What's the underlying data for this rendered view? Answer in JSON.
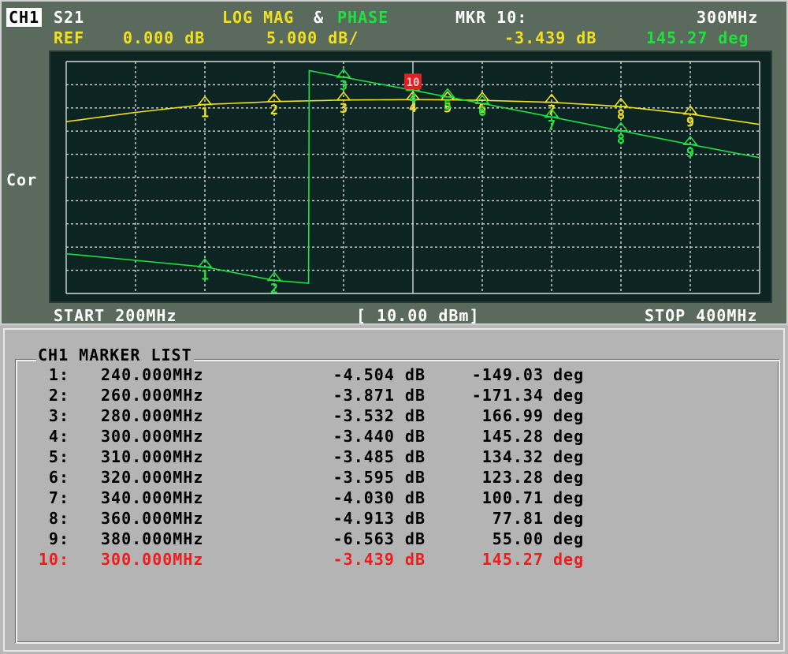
{
  "header": {
    "channel": "CH1",
    "param": "S21",
    "format_mag": "LOG MAG",
    "format_amp": "&",
    "format_phase": "PHASE",
    "marker_label": "MKR 10:",
    "marker_freq": "300MHz",
    "ref_label": "REF",
    "ref_value": "0.000 dB",
    "scale": "5.000 dB/",
    "marker_mag": "-3.439 dB",
    "marker_phase": "145.27 deg",
    "correction": "Cor"
  },
  "footer": {
    "start": "START 200MHz",
    "power": "[ 10.00 dBm]",
    "stop": "STOP 400MHz"
  },
  "chart_data": {
    "type": "line",
    "x_range_mhz": [
      200,
      400
    ],
    "mag_reference_db": 0.0,
    "mag_scale_db_per_div": 5.0,
    "grid": true,
    "series": [
      {
        "name": "LOG MAG",
        "color": "#f0e020",
        "x": [
          200,
          220,
          240,
          260,
          280,
          300,
          310,
          320,
          340,
          360,
          380,
          400
        ],
        "values": [
          -8.2,
          -6.2,
          -4.504,
          -3.871,
          -3.532,
          -3.44,
          -3.485,
          -3.595,
          -4.03,
          -4.913,
          -6.563,
          -8.8
        ]
      },
      {
        "name": "PHASE",
        "color": "#20e040",
        "x": [
          200,
          220,
          240,
          260,
          269.9,
          270.1,
          280,
          300,
          310,
          320,
          340,
          360,
          380,
          400
        ],
        "values": [
          -127.0,
          -138.0,
          -149.03,
          -171.34,
          -176.0,
          178.0,
          166.99,
          145.28,
          134.32,
          123.28,
          100.71,
          77.81,
          55.0,
          33.0
        ]
      }
    ],
    "markers": [
      {
        "id": "1",
        "freq_mhz": 240
      },
      {
        "id": "2",
        "freq_mhz": 260
      },
      {
        "id": "3",
        "freq_mhz": 280
      },
      {
        "id": "4",
        "freq_mhz": 300
      },
      {
        "id": "5",
        "freq_mhz": 310
      },
      {
        "id": "6",
        "freq_mhz": 320
      },
      {
        "id": "7",
        "freq_mhz": 340
      },
      {
        "id": "8",
        "freq_mhz": 360
      },
      {
        "id": "9",
        "freq_mhz": 380
      },
      {
        "id": "10",
        "freq_mhz": 300,
        "active": true
      }
    ]
  },
  "marker_list": {
    "title": "CH1 MARKER LIST",
    "rows": [
      {
        "idx": "1:",
        "freq": "240.000MHz",
        "mag": "-4.504 dB",
        "phase": "-149.03",
        "unit": "deg"
      },
      {
        "idx": "2:",
        "freq": "260.000MHz",
        "mag": "-3.871 dB",
        "phase": "-171.34",
        "unit": "deg"
      },
      {
        "idx": "3:",
        "freq": "280.000MHz",
        "mag": "-3.532 dB",
        "phase": "166.99",
        "unit": "deg"
      },
      {
        "idx": "4:",
        "freq": "300.000MHz",
        "mag": "-3.440 dB",
        "phase": "145.28",
        "unit": "deg"
      },
      {
        "idx": "5:",
        "freq": "310.000MHz",
        "mag": "-3.485 dB",
        "phase": "134.32",
        "unit": "deg"
      },
      {
        "idx": "6:",
        "freq": "320.000MHz",
        "mag": "-3.595 dB",
        "phase": "123.28",
        "unit": "deg"
      },
      {
        "idx": "7:",
        "freq": "340.000MHz",
        "mag": "-4.030 dB",
        "phase": "100.71",
        "unit": "deg"
      },
      {
        "idx": "8:",
        "freq": "360.000MHz",
        "mag": "-4.913 dB",
        "phase": "77.81",
        "unit": "deg"
      },
      {
        "idx": "9:",
        "freq": "380.000MHz",
        "mag": "-6.563 dB",
        "phase": "55.00",
        "unit": "deg"
      },
      {
        "idx": "10:",
        "freq": "300.000MHz",
        "mag": "-3.439 dB",
        "phase": "145.27",
        "unit": "deg",
        "active": true
      }
    ]
  }
}
